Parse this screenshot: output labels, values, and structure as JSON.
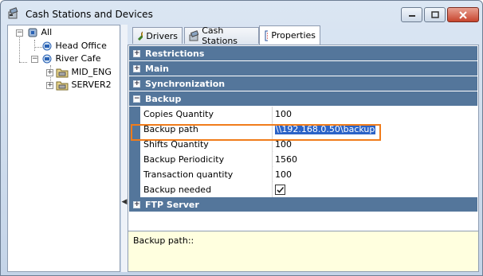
{
  "window": {
    "title": "Cash Stations and Devices",
    "icon": "cash-station-icon"
  },
  "tree": {
    "root": "All",
    "nodes": [
      {
        "label": "Head Office",
        "icon": "network-node-icon"
      },
      {
        "label": "River Cafe",
        "icon": "network-node-icon"
      },
      {
        "label": "MID_ENG",
        "icon": "folder-device-icon"
      },
      {
        "label": "SERVER2",
        "icon": "folder-device-icon"
      }
    ]
  },
  "tabs": [
    {
      "label": "Drivers",
      "icon": "drivers-icon"
    },
    {
      "label": "Cash Stations",
      "icon": "cash-station-icon"
    },
    {
      "label": "Properties",
      "icon": "properties-icon",
      "active": true
    }
  ],
  "grid": {
    "categories": {
      "restrictions": "Restrictions",
      "main": "Main",
      "synchronization": "Synchronization",
      "backup": "Backup",
      "ftp": "FTP Server"
    },
    "backup_props": [
      {
        "name": "Copies Quantity",
        "value": "100"
      },
      {
        "name": "Backup path",
        "value": "\\\\192.168.0.50\\backup"
      },
      {
        "name": "Shifts Quantity",
        "value": "100"
      },
      {
        "name": "Backup Periodicity",
        "value": "1560"
      },
      {
        "name": "Transaction quantity",
        "value": "100"
      },
      {
        "name": "Backup needed",
        "value": ""
      }
    ],
    "backup_needed_checked": true
  },
  "description": {
    "text": "Backup path::"
  },
  "colors": {
    "category_bg": "#54769b",
    "highlight": "#f07c1b",
    "selection": "#2b63c7",
    "description_bg": "#ffffdf"
  }
}
